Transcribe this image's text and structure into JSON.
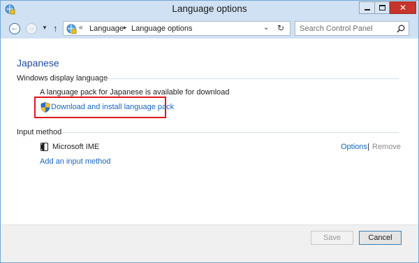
{
  "window": {
    "title": "Language options",
    "close_glyph": "✕"
  },
  "nav": {
    "back_glyph": "←",
    "forward_glyph": "→",
    "recent_glyph": "▼",
    "up_glyph": "↑",
    "address": {
      "chevron": "«",
      "crumbs": [
        "Language",
        "Language options"
      ],
      "crumb_separator": "▸",
      "dropdown_glyph": "⌄",
      "refresh_glyph": "↻"
    },
    "search": {
      "placeholder": "Search Control Panel"
    }
  },
  "content": {
    "language_title": "Japanese",
    "display_language": {
      "header": "Windows display language",
      "info": "A language pack for Japanese is available for download",
      "download_link": "Download and install language pack"
    },
    "input_method": {
      "header": "Input method",
      "ime_name": "Microsoft IME",
      "options_link": "Options",
      "separator": "|",
      "remove_label": "Remove",
      "add_link": "Add an input method"
    }
  },
  "footer": {
    "save_label": "Save",
    "cancel_label": "Cancel"
  },
  "colors": {
    "titlebar": "#cfe1f2",
    "link": "#1565c0",
    "heading": "#1f4e9c",
    "highlight_box": "#e2141b",
    "close_button": "#c7352c"
  },
  "icons": [
    "control-panel-icon",
    "back-arrow-icon",
    "forward-arrow-icon",
    "up-arrow-icon",
    "refresh-icon",
    "search-icon",
    "uac-shield-icon",
    "ime-icon"
  ]
}
